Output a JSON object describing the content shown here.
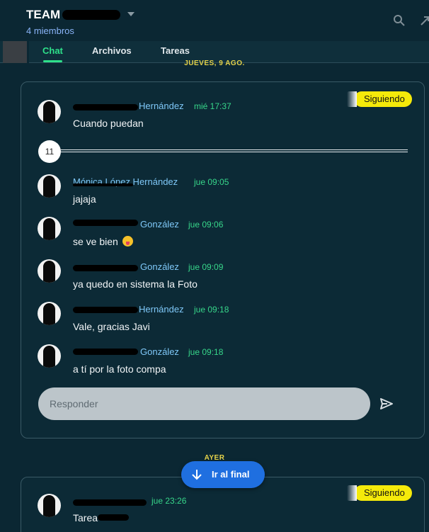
{
  "header": {
    "team_name": "TEAM S",
    "members": "4 miembros"
  },
  "tabs": [
    {
      "label": "Chat",
      "active": true
    },
    {
      "label": "Archivos",
      "active": false
    },
    {
      "label": "Tareas",
      "active": false
    }
  ],
  "date_separators": {
    "top": "JUEVES, 9 AGO.",
    "yesterday": "AYER"
  },
  "thread1": {
    "follow_label": "Siguiendo",
    "first_message": {
      "author_suffix": "Hernández",
      "time": "mié 17:37",
      "text": "Cuando puedan"
    },
    "hidden_count": "11",
    "messages": [
      {
        "author_suffix": "Mónica López Hernández",
        "time": "jue 09:05",
        "text": "jajaja"
      },
      {
        "author_suffix": "González",
        "time": "jue 09:06",
        "text": "se ve bien"
      },
      {
        "author_suffix": "González",
        "time": "jue 09:09",
        "text": "ya quedo en sistema la Foto"
      },
      {
        "author_suffix": "Hernández",
        "time": "jue 09:18",
        "text": "Vale, gracias Javi"
      },
      {
        "author_suffix": "González",
        "time": "jue 09:18",
        "text": "a tí por la foto compa"
      }
    ],
    "reply_placeholder": "Responder"
  },
  "thread2": {
    "follow_label": "Siguiendo",
    "first_message": {
      "time": "jue 23:26",
      "text": "Tarea"
    }
  },
  "goto_end_label": "Ir al final",
  "colors": {
    "background": "#0b2733",
    "accent_green": "#2ee08a",
    "author_blue": "#7fc8f8",
    "badge_yellow": "#f5ea0a",
    "date_yellow": "#e5d34a",
    "button_blue": "#1f6fe0"
  },
  "icons": [
    "caret-down-icon",
    "search-icon",
    "expand-icon",
    "send-icon",
    "arrow-down-icon",
    "tongue-emoji-icon"
  ]
}
